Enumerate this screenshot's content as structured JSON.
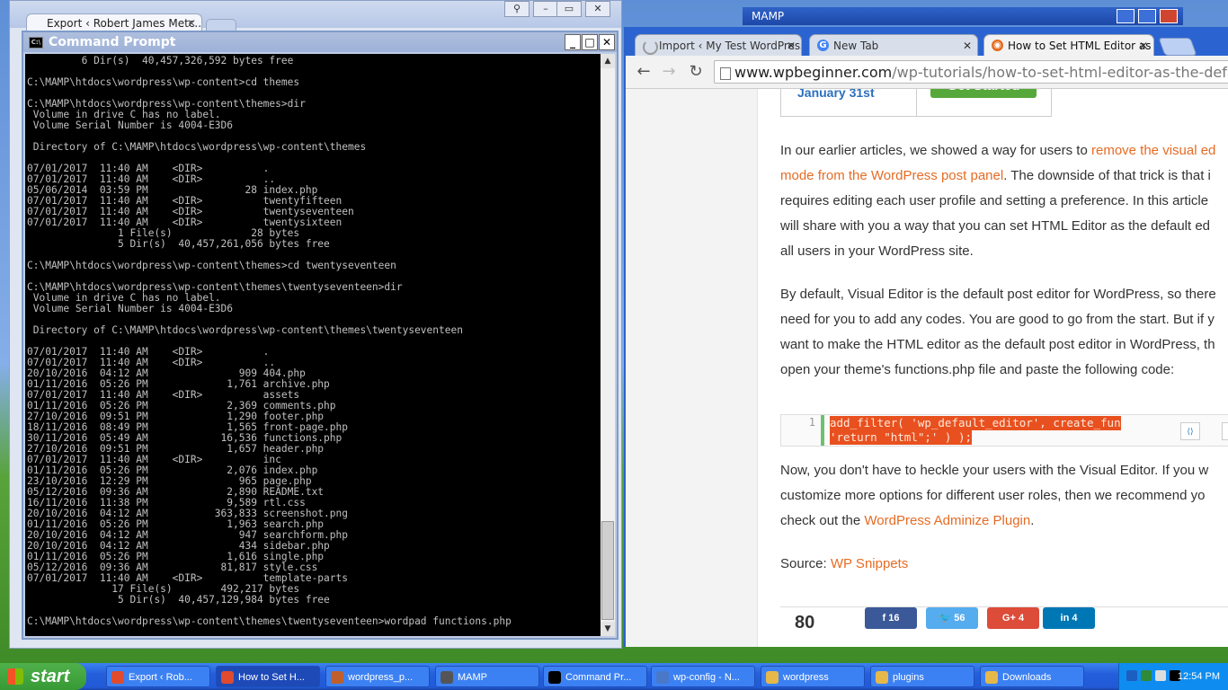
{
  "background_window": {
    "tab_title": "Export ‹ Robert James Metc...",
    "mamp_title": "MAMP"
  },
  "cmd": {
    "title": "Command Prompt",
    "lines": [
      "         6 Dir(s)  40,457,326,592 bytes free",
      "",
      "C:\\MAMP\\htdocs\\wordpress\\wp-content>cd themes",
      "",
      "C:\\MAMP\\htdocs\\wordpress\\wp-content\\themes>dir",
      " Volume in drive C has no label.",
      " Volume Serial Number is 4004-E3D6",
      "",
      " Directory of C:\\MAMP\\htdocs\\wordpress\\wp-content\\themes",
      "",
      "07/01/2017  11:40 AM    <DIR>          .",
      "07/01/2017  11:40 AM    <DIR>          ..",
      "05/06/2014  03:59 PM                28 index.php",
      "07/01/2017  11:40 AM    <DIR>          twentyfifteen",
      "07/01/2017  11:40 AM    <DIR>          twentyseventeen",
      "07/01/2017  11:40 AM    <DIR>          twentysixteen",
      "               1 File(s)             28 bytes",
      "               5 Dir(s)  40,457,261,056 bytes free",
      "",
      "C:\\MAMP\\htdocs\\wordpress\\wp-content\\themes>cd twentyseventeen",
      "",
      "C:\\MAMP\\htdocs\\wordpress\\wp-content\\themes\\twentyseventeen>dir",
      " Volume in drive C has no label.",
      " Volume Serial Number is 4004-E3D6",
      "",
      " Directory of C:\\MAMP\\htdocs\\wordpress\\wp-content\\themes\\twentyseventeen",
      "",
      "07/01/2017  11:40 AM    <DIR>          .",
      "07/01/2017  11:40 AM    <DIR>          ..",
      "20/10/2016  04:12 AM               909 404.php",
      "01/11/2016  05:26 PM             1,761 archive.php",
      "07/01/2017  11:40 AM    <DIR>          assets",
      "01/11/2016  05:26 PM             2,369 comments.php",
      "27/10/2016  09:51 PM             1,290 footer.php",
      "18/11/2016  08:49 PM             1,565 front-page.php",
      "30/11/2016  05:49 AM            16,536 functions.php",
      "27/10/2016  09:51 PM             1,657 header.php",
      "07/01/2017  11:40 AM    <DIR>          inc",
      "01/11/2016  05:26 PM             2,076 index.php",
      "23/10/2016  12:29 PM               965 page.php",
      "05/12/2016  09:36 AM             2,890 README.txt",
      "16/11/2016  11:38 PM             9,589 rtl.css",
      "20/10/2016  04:12 AM           363,833 screenshot.png",
      "01/11/2016  05:26 PM             1,963 search.php",
      "20/10/2016  04:12 AM               947 searchform.php",
      "20/10/2016  04:12 AM               434 sidebar.php",
      "01/11/2016  05:26 PM             1,616 single.php",
      "05/12/2016  09:36 AM            81,817 style.css",
      "07/01/2017  11:40 AM    <DIR>          template-parts",
      "              17 File(s)        492,217 bytes",
      "               5 Dir(s)  40,457,129,984 bytes free",
      "",
      "C:\\MAMP\\htdocs\\wordpress\\wp-content\\themes\\twentyseventeen>wordpad functions.php"
    ]
  },
  "chrome": {
    "tabs": [
      {
        "label": "Import ‹ My Test WordPress",
        "active": false
      },
      {
        "label": "New Tab",
        "active": false
      },
      {
        "label": "How to Set HTML Editor as th",
        "active": true
      }
    ],
    "url_host": "www.wpbeginner.com",
    "url_path": "/wp-tutorials/how-to-set-html-editor-as-the-default-pos"
  },
  "article": {
    "promo_date": "January 31st",
    "promo_button": "Get Started",
    "p1": [
      {
        "text": "In our earlier articles, we showed a way for users to ",
        "link": "remove the visual ed"
      },
      {
        "text": "",
        "link": "mode from the WordPress post panel",
        "after": ". The downside of that trick is that i"
      },
      {
        "text": "requires editing each user profile and setting a preference. In this article"
      },
      {
        "text": "will share with you a way that you can set HTML Editor as the default ed"
      },
      {
        "text": "all users in your WordPress site."
      }
    ],
    "p2": [
      "By default, Visual Editor is the default post editor for WordPress, so there",
      "need for you to add any codes. You are good to go from the start. But if y",
      "want to make the HTML editor as the default post editor in WordPress, th",
      "open your theme's functions.php file and paste the following code:"
    ],
    "code_line_number": "1",
    "code_line1": "add_filter( 'wp_default_editor', create_fun",
    "code_line2": "'return \"html\";' ) );",
    "p3_line1": "Now, you don't have to heckle your users with the Visual Editor. If you w",
    "p3_line2": "customize more options for different user roles, then we recommend yo",
    "p3_line3_text": "check out the ",
    "p3_link": "WordPress Adminize Plugin",
    "p3_line3_end": ".",
    "source_label": "Source: ",
    "source_link": "WP Snippets",
    "share_count": "80",
    "share_buttons": [
      {
        "label": "f  16",
        "color": "#3b5998"
      },
      {
        "label": "🐦 56",
        "color": "#55acee"
      },
      {
        "label": "G+ 4",
        "color": "#dd4b39"
      },
      {
        "label": "in  4",
        "color": "#0077b5"
      }
    ]
  },
  "taskbar": {
    "start_label": "start",
    "items": [
      {
        "label": "Export ‹ Rob...",
        "icon": "chrome-icon",
        "color": "#e04a2f"
      },
      {
        "label": "How to Set H...",
        "icon": "chrome-icon",
        "color": "#e04a2f",
        "active": true
      },
      {
        "label": "wordpress_p...",
        "icon": "wordpad-icon",
        "color": "#c05f2c"
      },
      {
        "label": "MAMP",
        "icon": "mamp-icon",
        "color": "#555"
      },
      {
        "label": "Command Pr...",
        "icon": "cmd-icon",
        "color": "#000"
      },
      {
        "label": "wp-config - N...",
        "icon": "notepad-icon",
        "color": "#4a78c8"
      },
      {
        "label": "wordpress",
        "icon": "folder-icon",
        "color": "#e6b84a"
      },
      {
        "label": "plugins",
        "icon": "folder-icon",
        "color": "#e6b84a"
      },
      {
        "label": "Downloads",
        "icon": "folder-icon",
        "color": "#e6b84a"
      }
    ],
    "clock": "12:54 PM"
  }
}
